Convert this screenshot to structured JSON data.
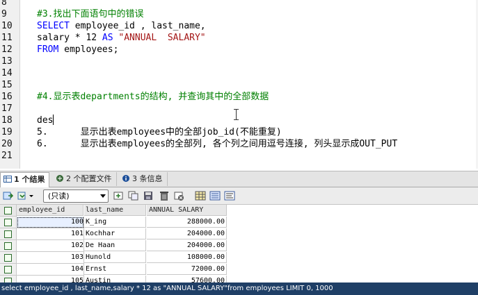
{
  "editor": {
    "lines": [
      {
        "num": "8",
        "segments": []
      },
      {
        "num": "9",
        "segments": [
          {
            "cls": "cm",
            "text": "#3.找出下面语句中的错误"
          }
        ]
      },
      {
        "num": "10",
        "segments": [
          {
            "cls": "kw",
            "text": "SELECT"
          },
          {
            "cls": "",
            "text": " employee_id , last_name,"
          }
        ]
      },
      {
        "num": "11",
        "segments": [
          {
            "cls": "",
            "text": "salary * 12 "
          },
          {
            "cls": "kw",
            "text": "AS"
          },
          {
            "cls": "",
            "text": " "
          },
          {
            "cls": "st",
            "text": "\"ANNUAL  SALARY\""
          }
        ]
      },
      {
        "num": "12",
        "segments": [
          {
            "cls": "kw",
            "text": "FROM"
          },
          {
            "cls": "",
            "text": " employees;"
          }
        ]
      },
      {
        "num": "13",
        "segments": []
      },
      {
        "num": "14",
        "segments": []
      },
      {
        "num": "15",
        "segments": []
      },
      {
        "num": "16",
        "segments": [
          {
            "cls": "cm",
            "text": "#4.显示表departments的结构, 并查询其中的全部数据"
          }
        ]
      },
      {
        "num": "17",
        "segments": []
      },
      {
        "num": "18",
        "segments": [
          {
            "cls": "",
            "text": "des"
          }
        ],
        "cursor": true
      },
      {
        "num": "19",
        "segments": [
          {
            "cls": "",
            "text": "5.      显示出表employees中的全部job_id(不能重复)"
          }
        ]
      },
      {
        "num": "20",
        "segments": [
          {
            "cls": "",
            "text": "6.      显示出表employees的全部列, 各个列之间用逗号连接, 列头显示成OUT_PUT"
          }
        ]
      },
      {
        "num": "21",
        "segments": []
      }
    ]
  },
  "tabs": [
    {
      "label": "1 个结果",
      "active": true,
      "icon": "result-grid-icon"
    },
    {
      "label": "2 个配置文件",
      "active": false,
      "icon": "profile-icon"
    },
    {
      "label": "3 条信息",
      "active": false,
      "icon": "info-icon"
    }
  ],
  "toolbar": {
    "mode_select": "(只读)"
  },
  "grid": {
    "columns": [
      "employee_id",
      "last_name",
      "ANNUAL  SALARY"
    ],
    "rows": [
      [
        "100",
        "K_ing",
        "288000.00"
      ],
      [
        "101",
        "Kochhar",
        "204000.00"
      ],
      [
        "102",
        "De Haan",
        "204000.00"
      ],
      [
        "103",
        "Hunold",
        "108000.00"
      ],
      [
        "104",
        "Ernst",
        "72000.00"
      ],
      [
        "105",
        "Austin",
        "57600.00"
      ]
    ]
  },
  "status": {
    "text": "select employee_id , last_name,salary * 12 as \"ANNUAL  SALARY\"from employees LIMIT 0, 1000"
  },
  "colors": {
    "comment": "#008000",
    "keyword": "#0000ff",
    "string": "#a31515",
    "status_bar": "#1f3f66"
  }
}
